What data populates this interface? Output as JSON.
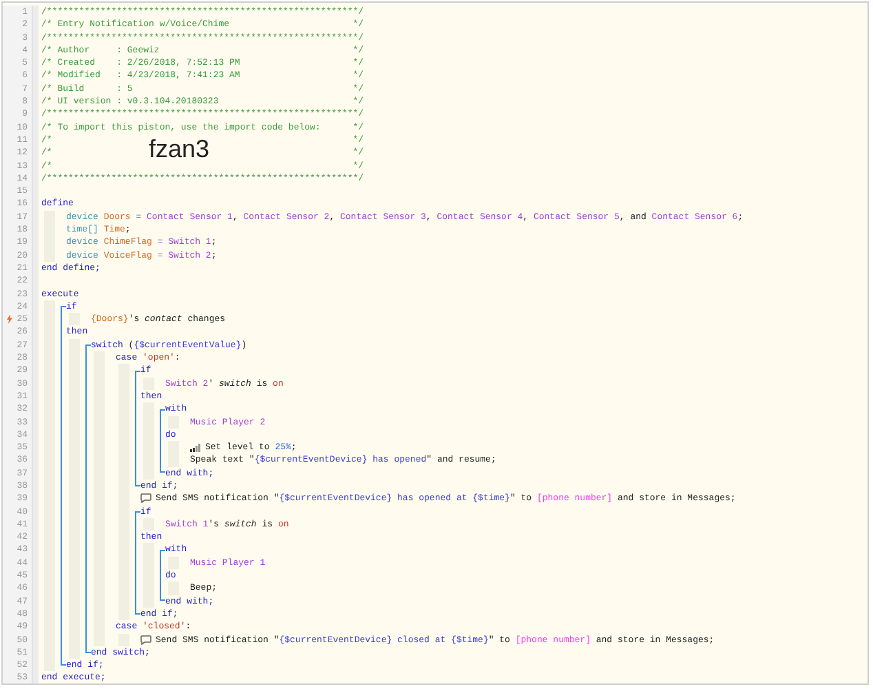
{
  "lines": [
    {
      "n": "1",
      "tokens": [
        {
          "text": "/**********************************************************/",
          "kind": "comment"
        }
      ]
    },
    {
      "n": "2",
      "tokens": [
        {
          "text": "/* Entry Notification w/Voice/Chime",
          "kind": "comment_box"
        },
        {
          "text": "*/",
          "kind": "comment"
        }
      ]
    },
    {
      "n": "3",
      "tokens": [
        {
          "text": "/**********************************************************/",
          "kind": "comment"
        }
      ]
    },
    {
      "n": "4",
      "tokens": [
        {
          "text": "/* Author     : Geewiz",
          "kind": "comment_box"
        },
        {
          "text": "*/",
          "kind": "comment"
        }
      ]
    },
    {
      "n": "5",
      "tokens": [
        {
          "text": "/* Created    : 2/26/2018, 7:52:13 PM",
          "kind": "comment_box"
        },
        {
          "text": "*/",
          "kind": "comment"
        }
      ]
    },
    {
      "n": "6",
      "tokens": [
        {
          "text": "/* Modified   : 4/23/2018, 7:41:23 AM",
          "kind": "comment_box"
        },
        {
          "text": "*/",
          "kind": "comment"
        }
      ]
    },
    {
      "n": "7",
      "tokens": [
        {
          "text": "/* Build      : 5",
          "kind": "comment_box"
        },
        {
          "text": "*/",
          "kind": "comment"
        }
      ]
    },
    {
      "n": "8",
      "tokens": [
        {
          "text": "/* UI version : v0.3.104.20180323",
          "kind": "comment_box"
        },
        {
          "text": "*/",
          "kind": "comment"
        }
      ]
    },
    {
      "n": "9",
      "tokens": [
        {
          "text": "/**********************************************************/",
          "kind": "comment"
        }
      ]
    },
    {
      "n": "10",
      "tokens": [
        {
          "text": "/* To import this piston, use the import code below:",
          "kind": "comment_box"
        },
        {
          "text": "*/",
          "kind": "comment"
        }
      ]
    },
    {
      "n": "11",
      "tokens": [
        {
          "text": "/*",
          "kind": "comment_box"
        },
        {
          "text": "*/",
          "kind": "comment"
        }
      ]
    },
    {
      "n": "12",
      "tokens": [
        {
          "text": "/*",
          "kind": "comment"
        },
        {
          "text": "fzan3",
          "kind": "import_code"
        },
        {
          "text": "*/",
          "kind": "comment"
        }
      ]
    },
    {
      "n": "13",
      "tokens": [
        {
          "text": "/*",
          "kind": "comment_box"
        },
        {
          "text": "*/",
          "kind": "comment"
        }
      ]
    },
    {
      "n": "14",
      "tokens": [
        {
          "text": "/**********************************************************/",
          "kind": "comment"
        }
      ]
    },
    {
      "n": "15"
    },
    {
      "n": "16",
      "tokens": [
        {
          "text": "define",
          "kind": "keyword"
        }
      ]
    },
    {
      "n": "17",
      "tokens": [
        {
          "text": "    device ",
          "kind": "type"
        },
        {
          "text": "Doors",
          "kind": "variable"
        },
        {
          "text": " = ",
          "kind": "operator"
        },
        {
          "text": "Contact Sensor 1",
          "kind": "device"
        },
        {
          "text": ", ",
          "kind": "plain"
        },
        {
          "text": "Contact Sensor 2",
          "kind": "device"
        },
        {
          "text": ", ",
          "kind": "plain"
        },
        {
          "text": "Contact Sensor 3",
          "kind": "device"
        },
        {
          "text": ", ",
          "kind": "plain"
        },
        {
          "text": "Contact Sensor 4",
          "kind": "device"
        },
        {
          "text": ", ",
          "kind": "plain"
        },
        {
          "text": "Contact Sensor 5",
          "kind": "device"
        },
        {
          "text": ", and ",
          "kind": "plain"
        },
        {
          "text": "Contact Sensor 6",
          "kind": "device"
        },
        {
          "text": ";",
          "kind": "plain"
        }
      ]
    },
    {
      "n": "18",
      "tokens": [
        {
          "text": "    time[] ",
          "kind": "type"
        },
        {
          "text": "Time",
          "kind": "variable"
        },
        {
          "text": ";",
          "kind": "plain"
        }
      ]
    },
    {
      "n": "19",
      "tokens": [
        {
          "text": "    device ",
          "kind": "type"
        },
        {
          "text": "ChimeFlag",
          "kind": "variable"
        },
        {
          "text": " = ",
          "kind": "operator"
        },
        {
          "text": "Switch 1",
          "kind": "device"
        },
        {
          "text": ";",
          "kind": "plain"
        }
      ]
    },
    {
      "n": "20",
      "tokens": [
        {
          "text": "    device ",
          "kind": "type"
        },
        {
          "text": "VoiceFlag",
          "kind": "variable"
        },
        {
          "text": " = ",
          "kind": "operator"
        },
        {
          "text": "Switch 2",
          "kind": "device"
        },
        {
          "text": ";",
          "kind": "plain"
        }
      ]
    },
    {
      "n": "21",
      "tokens": [
        {
          "text": "end define;",
          "kind": "keyword"
        }
      ]
    },
    {
      "n": "22"
    },
    {
      "n": "23",
      "tokens": [
        {
          "text": "execute",
          "kind": "keyword"
        }
      ]
    },
    {
      "n": "24",
      "block_start": true,
      "tokens": [
        {
          "text": "    if",
          "kind": "keyword"
        }
      ]
    },
    {
      "n": "25",
      "trigger": true,
      "tokens": [
        {
          "text": "        {Doors}",
          "kind": "variable"
        },
        {
          "text": "'s ",
          "kind": "plain"
        },
        {
          "text": "contact",
          "kind": "attr"
        },
        {
          "text": " changes",
          "kind": "plain"
        }
      ]
    },
    {
      "n": "26",
      "tokens": [
        {
          "text": "    then",
          "kind": "keyword"
        }
      ]
    },
    {
      "n": "27",
      "block_start": true,
      "tokens": [
        {
          "text": "        switch",
          "kind": "keyword"
        },
        {
          "text": " (",
          "kind": "plain"
        },
        {
          "text": "{$currentEventValue}",
          "kind": "expr"
        },
        {
          "text": ")",
          "kind": "plain"
        }
      ]
    },
    {
      "n": "28",
      "tokens": [
        {
          "text": "            case ",
          "kind": "keyword"
        },
        {
          "text": "'open'",
          "kind": "string"
        },
        {
          "text": ":",
          "kind": "plain"
        }
      ]
    },
    {
      "n": "29",
      "block_start": true,
      "tokens": [
        {
          "text": "                if",
          "kind": "keyword"
        }
      ]
    },
    {
      "n": "30",
      "tokens": [
        {
          "text": "                    Switch 2",
          "kind": "device"
        },
        {
          "text": "' ",
          "kind": "plain"
        },
        {
          "text": "switch",
          "kind": "attr"
        },
        {
          "text": " is ",
          "kind": "plain"
        },
        {
          "text": "on",
          "kind": "value"
        }
      ]
    },
    {
      "n": "31",
      "tokens": [
        {
          "text": "                then",
          "kind": "keyword"
        }
      ]
    },
    {
      "n": "32",
      "block_start": true,
      "tokens": [
        {
          "text": "                    with",
          "kind": "keyword"
        }
      ]
    },
    {
      "n": "33",
      "tokens": [
        {
          "text": "                        Music Player 2",
          "kind": "device"
        }
      ]
    },
    {
      "n": "34",
      "tokens": [
        {
          "text": "                    do",
          "kind": "keyword"
        }
      ]
    },
    {
      "n": "35",
      "kind": "set_level",
      "tokens": [
        {
          "text": "                        Set level to ",
          "kind": "plain"
        },
        {
          "text": "25%",
          "kind": "number"
        },
        {
          "text": ";",
          "kind": "plain"
        }
      ]
    },
    {
      "n": "36",
      "tokens": [
        {
          "text": "                        Speak text \"",
          "kind": "plain"
        },
        {
          "text": "{$currentEventDevice} has opened",
          "kind": "expr"
        },
        {
          "text": "\" and resume;",
          "kind": "plain"
        }
      ]
    },
    {
      "n": "37",
      "block_end": true,
      "tokens": [
        {
          "text": "                    end with;",
          "kind": "keyword"
        }
      ]
    },
    {
      "n": "38",
      "block_end": true,
      "tokens": [
        {
          "text": "                end if;",
          "kind": "keyword"
        }
      ]
    },
    {
      "n": "39",
      "kind": "notify",
      "tokens": [
        {
          "text": "                Send SMS notification \"",
          "kind": "plain"
        },
        {
          "text": "{$currentEventDevice} has opened at {$time}",
          "kind": "expr"
        },
        {
          "text": "\" to ",
          "kind": "plain"
        },
        {
          "text": "[phone number]",
          "kind": "phone"
        },
        {
          "text": " and store in Messages;",
          "kind": "plain"
        }
      ]
    },
    {
      "n": "40",
      "block_start": true,
      "tokens": [
        {
          "text": "                if",
          "kind": "keyword"
        }
      ]
    },
    {
      "n": "41",
      "tokens": [
        {
          "text": "                    Switch 1",
          "kind": "device"
        },
        {
          "text": "'s ",
          "kind": "plain"
        },
        {
          "text": "switch",
          "kind": "attr"
        },
        {
          "text": " is ",
          "kind": "plain"
        },
        {
          "text": "on",
          "kind": "value"
        }
      ]
    },
    {
      "n": "42",
      "tokens": [
        {
          "text": "                then",
          "kind": "keyword"
        }
      ]
    },
    {
      "n": "43",
      "block_start": true,
      "tokens": [
        {
          "text": "                    with",
          "kind": "keyword"
        }
      ]
    },
    {
      "n": "44",
      "tokens": [
        {
          "text": "                        Music Player 1",
          "kind": "device"
        }
      ]
    },
    {
      "n": "45",
      "tokens": [
        {
          "text": "                    do",
          "kind": "keyword"
        }
      ]
    },
    {
      "n": "46",
      "tokens": [
        {
          "text": "                        Beep;",
          "kind": "plain"
        }
      ]
    },
    {
      "n": "47",
      "block_end": true,
      "tokens": [
        {
          "text": "                    end with;",
          "kind": "keyword"
        }
      ]
    },
    {
      "n": "48",
      "block_end": true,
      "tokens": [
        {
          "text": "                end if;",
          "kind": "keyword"
        }
      ]
    },
    {
      "n": "49",
      "tokens": [
        {
          "text": "            case ",
          "kind": "keyword"
        },
        {
          "text": "'closed'",
          "kind": "string"
        },
        {
          "text": ":",
          "kind": "plain"
        }
      ]
    },
    {
      "n": "50",
      "kind": "notify",
      "tokens": [
        {
          "text": "                Send SMS notification \"",
          "kind": "plain"
        },
        {
          "text": "{$currentEventDevice} closed at {$time}",
          "kind": "expr"
        },
        {
          "text": "\" to ",
          "kind": "plain"
        },
        {
          "text": "[phone number]",
          "kind": "phone"
        },
        {
          "text": " and store in Messages;",
          "kind": "plain"
        }
      ]
    },
    {
      "n": "51",
      "block_end": true,
      "tokens": [
        {
          "text": "        end switch;",
          "kind": "keyword"
        }
      ]
    },
    {
      "n": "52",
      "block_end": true,
      "tokens": [
        {
          "text": "    end if;",
          "kind": "keyword"
        }
      ]
    },
    {
      "n": "53",
      "tokens": [
        {
          "text": "end execute;",
          "kind": "keyword"
        }
      ]
    }
  ]
}
